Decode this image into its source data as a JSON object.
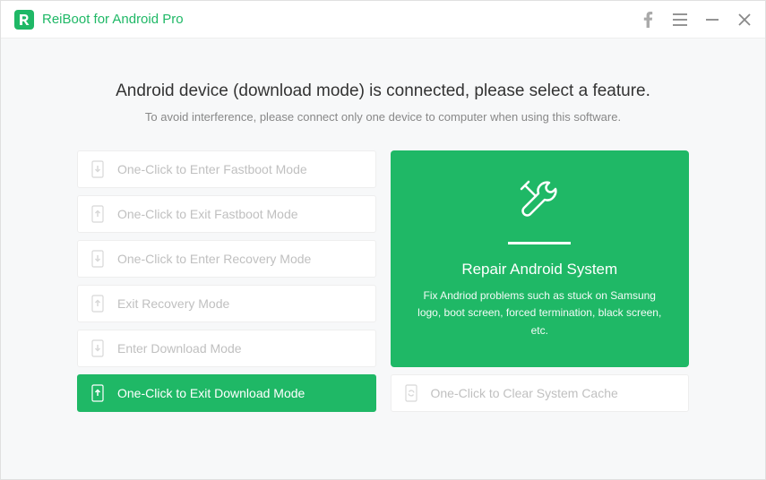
{
  "titlebar": {
    "app_title": "ReiBoot for Android Pro"
  },
  "heading": "Android device (download mode) is connected, please select a feature.",
  "subheading": "To avoid interference, please connect only one device to computer when using this software.",
  "features": {
    "enter_fastboot": "One-Click to Enter Fastboot Mode",
    "exit_fastboot": "One-Click to Exit Fastboot Mode",
    "enter_recovery": "One-Click to Enter Recovery Mode",
    "exit_recovery": "Exit Recovery Mode",
    "enter_download": "Enter Download Mode",
    "exit_download": "One-Click to Exit Download Mode",
    "clear_cache": "One-Click to Clear System Cache"
  },
  "repair": {
    "title": "Repair Android System",
    "description": "Fix Andriod problems such as stuck on Samsung logo, boot screen, forced termination, black screen, etc."
  },
  "colors": {
    "brand_green": "#1fb866",
    "disabled_text": "#c0c0c0"
  }
}
